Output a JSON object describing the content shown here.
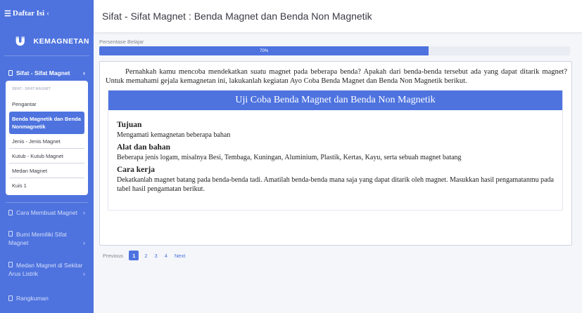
{
  "sidebar": {
    "toggle_label": "Daftar Isi",
    "brand": "KEMAGNETAN",
    "active_section": "Sifat - Sifat Magnet",
    "submenu_header": "SIFAT - SIFAT MAGNET",
    "submenu": [
      "Pengantar",
      "Benda Magnetik dan Benda Nonmagnetik",
      "Jenis - Jenis Magnet",
      "Kutub - Kutub Magnet",
      "Medan Magnet",
      "Kuis 1"
    ],
    "sections": [
      "Cara Membuat Magnet",
      "Bumi Memiliki Sifat Magnet",
      "Medan Magnet di Sekitar Arus Listrik",
      "Rangkuman"
    ],
    "accent": "#4e73df"
  },
  "header": {
    "title": "Sifat - Sifat Magnet : Benda Magnet dan Benda Non Magnetik"
  },
  "progress": {
    "label": "Persentase Belajar",
    "value": 0.7,
    "text": "70%"
  },
  "content": {
    "intro": "Pernahkah kamu mencoba mendekatkan suatu magnet pada beberapa benda? Apakah dari benda-benda tersebut ada yang dapat ditarik magnet? Untuk memahami gejala kemagnetan ini, lakukanlah kegiatan Ayo Coba Benda Magnet dan Benda Non Magnetik berikut.",
    "activity_title": "Uji Coba Benda Magnet dan Benda Non Magnetik",
    "tujuan_heading": "Tujuan",
    "tujuan_text": "Mengamati kemagnetan beberapa bahan",
    "alat_heading": "Alat dan bahan",
    "alat_text": "Beberapa jenis logam, misalnya Besi, Tembaga, Kuningan, Aluminium, Plastik, Kertas, Kayu, serta sebuah magnet batang",
    "cara_heading": "Cara kerja",
    "cara_text": "Dekatkanlah magnet batang pada benda-benda tadi. Amatilah benda-benda mana saja yang dapat ditarik oleh magnet. Masukkan hasil pengamatanmu pada tabel hasil pengamatan berikut."
  },
  "pagination": {
    "prev": "Previous",
    "pages": [
      "1",
      "2",
      "3",
      "4"
    ],
    "next": "Next"
  }
}
